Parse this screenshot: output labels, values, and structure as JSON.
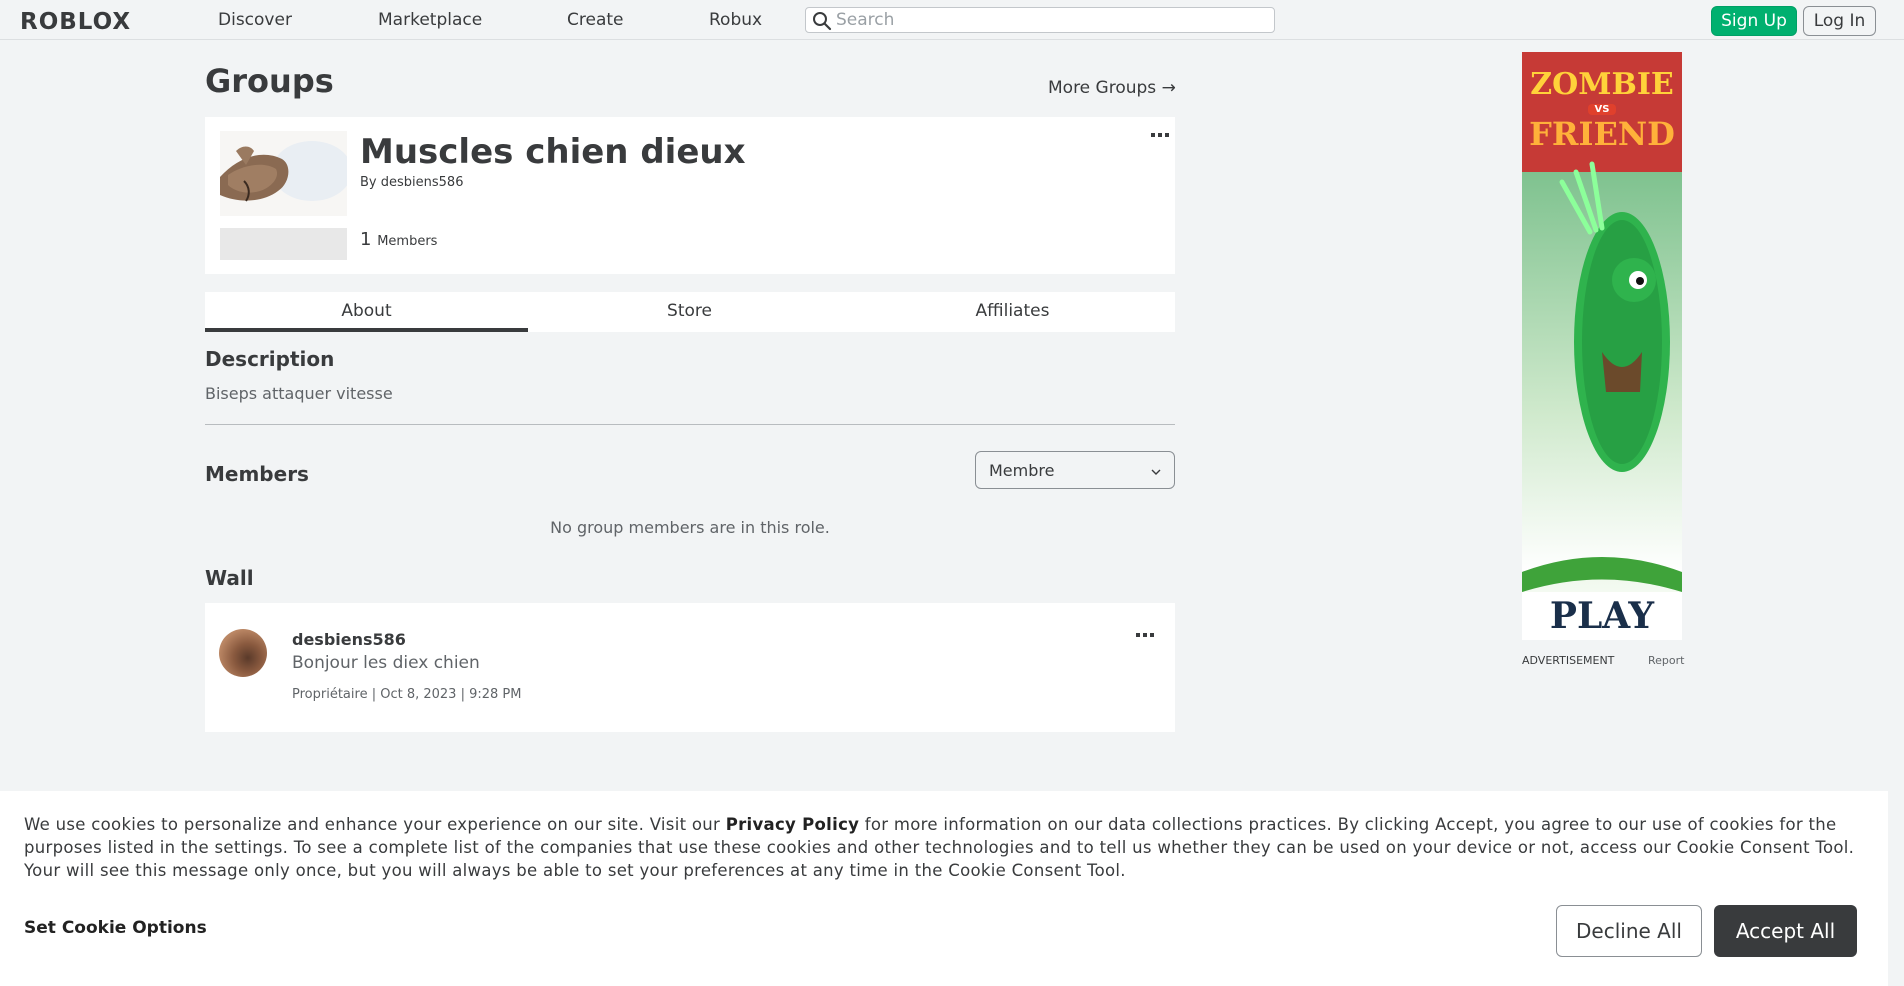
{
  "topbar": {
    "logo": "ROBLOX",
    "nav": [
      "Discover",
      "Marketplace",
      "Create",
      "Robux"
    ],
    "search_placeholder": "Search",
    "signup_label": "Sign Up",
    "login_label": "Log In"
  },
  "page": {
    "title": "Groups",
    "more_groups": "More Groups →"
  },
  "group": {
    "name": "Muscles chien dieux",
    "by_prefix": "By",
    "owner": "desbiens586",
    "member_count": "1",
    "members_label": "Members"
  },
  "tabs": [
    "About",
    "Store",
    "Affiliates"
  ],
  "description": {
    "title": "Description",
    "text": "Biseps attaquer vitesse"
  },
  "members": {
    "title": "Members",
    "role_selected": "Membre",
    "empty_text": "No group members are in this role."
  },
  "wall": {
    "title": "Wall",
    "posts": [
      {
        "user": "desbiens586",
        "text": "Bonjour les diex chien",
        "meta": "Propriétaire | Oct 8, 2023 | 9:28 PM"
      }
    ]
  },
  "ad": {
    "headline_top": "ZOMBIE",
    "headline_vs": "VS",
    "headline_bottom": "FRIEND",
    "cta": "PLAY",
    "label": "ADVERTISEMENT",
    "report": "Report"
  },
  "cookie": {
    "text_before": "We use cookies to personalize and enhance your experience on our site. Visit our",
    "privacy_link": "Privacy Policy",
    "text_after": "for more information on our data collections practices. By clicking Accept, you agree to our use of cookies for the purposes listed in the settings. To see a complete list of the companies that use these cookies and other technologies and to tell us whether they can be used on your device or not, access our Cookie Consent Tool. Your will see this message only once, but you will always be able to set your preferences at any time in the Cookie Consent Tool.",
    "options_label": "Set Cookie Options",
    "decline_label": "Decline All",
    "accept_label": "Accept All"
  },
  "colors": {
    "signup_green": "#00b06f",
    "text_dark": "#393b3d",
    "page_bg": "#f2f4f5"
  },
  "icons": [
    "search-icon",
    "arrow-right-icon",
    "more-dots-icon",
    "chevron-down-icon"
  ]
}
